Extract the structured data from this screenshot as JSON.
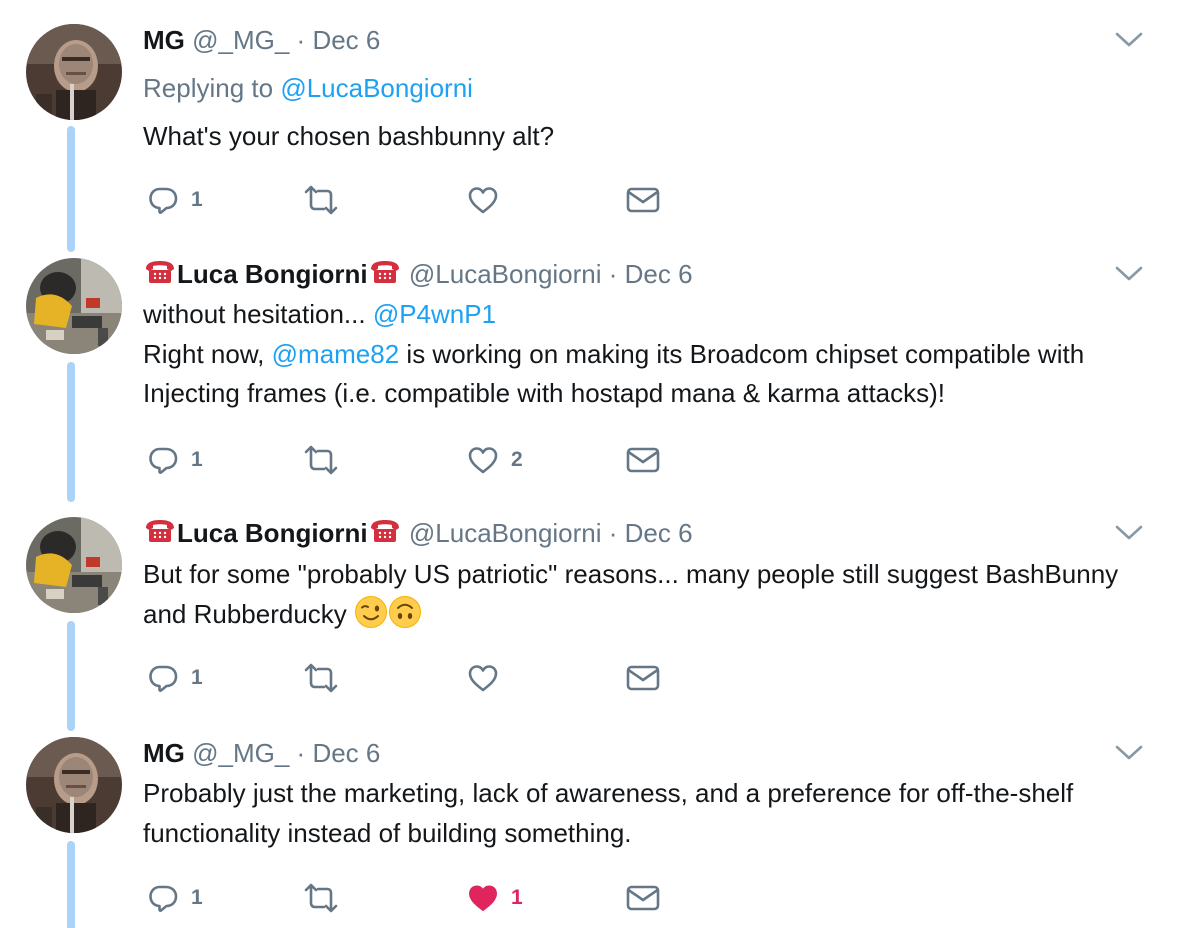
{
  "tweets": [
    {
      "name": "MG",
      "handle": "@_MG_",
      "sep": " · ",
      "date": "Dec 6",
      "reply_prefix": "Replying to ",
      "reply_handle": "@LucaBongiorni",
      "text": "What's your chosen bashbunny alt?",
      "replies": "1",
      "retweets": "",
      "likes": "",
      "liked": false
    },
    {
      "name": "Luca Bongiorni",
      "name_emoji": "telephone-emoji",
      "handle": "@LucaBongiorni",
      "sep": " · ",
      "date": "Dec 6",
      "text_line1_a": "without hesitation... ",
      "text_line1_mention": "@P4wnP1",
      "text_line2_a": "Right now, ",
      "text_line2_mention": "@mame82",
      "text_line2_b": " is working on making its Broadcom chipset compatible with Injecting frames (i.e. compatible with hostapd mana & karma attacks)!",
      "replies": "1",
      "retweets": "",
      "likes": "2",
      "liked": false
    },
    {
      "name": "Luca Bongiorni",
      "name_emoji": "telephone-emoji",
      "handle": "@LucaBongiorni",
      "sep": " · ",
      "date": "Dec 6",
      "text": "But for some \"probably US patriotic\" reasons... many people still suggest BashBunny and Rubberducky ",
      "text_emojis": [
        "winking-face-emoji",
        "upside-down-face-emoji"
      ],
      "replies": "1",
      "retweets": "",
      "likes": "",
      "liked": false
    },
    {
      "name": "MG",
      "handle": "@_MG_",
      "sep": " · ",
      "date": "Dec 6",
      "text": "Probably just the marketing, lack of awareness, and a preference for off-the-shelf functionality instead of building something.",
      "replies": "1",
      "retweets": "",
      "likes": "1",
      "liked": true
    }
  ],
  "icons": {
    "reply": "reply-icon",
    "retweet": "retweet-icon",
    "like": "heart-icon",
    "dm": "envelope-icon",
    "caret": "chevron-down-icon"
  },
  "colors": {
    "text": "#14171a",
    "secondary": "#657786",
    "link": "#1da1f2",
    "thread_line": "#aad3f7",
    "liked": "#e0245e"
  }
}
